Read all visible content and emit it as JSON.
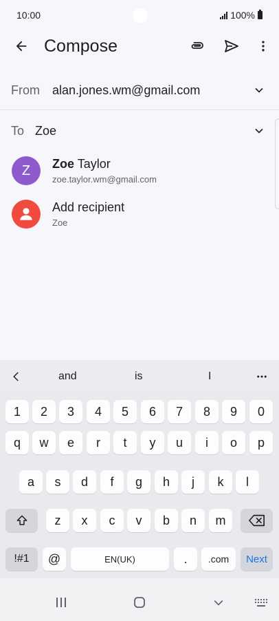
{
  "status_bar": {
    "time": "10:00",
    "battery": "100%"
  },
  "app_bar": {
    "title": "Compose"
  },
  "from": {
    "label": "From",
    "value": "alan.jones.wm@gmail.com"
  },
  "to": {
    "label": "To",
    "value": "Zoe"
  },
  "suggestions": [
    {
      "initial": "Z",
      "name_bold": "Zoe",
      "name_rest": " Taylor",
      "email": "zoe.taylor.wm@gmail.com",
      "avatar_color": "#8e5bcf"
    },
    {
      "name": "Add recipient",
      "sub": "Zoe",
      "avatar_color": "#f04b3e"
    }
  ],
  "keyboard": {
    "suggestions": [
      "and",
      "is",
      "I"
    ],
    "number_row": [
      "1",
      "2",
      "3",
      "4",
      "5",
      "6",
      "7",
      "8",
      "9",
      "0"
    ],
    "row1": [
      "q",
      "w",
      "e",
      "r",
      "t",
      "y",
      "u",
      "i",
      "o",
      "p"
    ],
    "row2": [
      "a",
      "s",
      "d",
      "f",
      "g",
      "h",
      "j",
      "k",
      "l"
    ],
    "row3": [
      "z",
      "x",
      "c",
      "v",
      "b",
      "n",
      "m"
    ],
    "symbols_label": "!#1",
    "at_label": "@",
    "space_label": "EN(UK)",
    "period_label": ".",
    "dotcom_label": ".com",
    "next_label": "Next"
  },
  "icons": {
    "back": "arrow-left-icon",
    "attach": "paperclip-icon",
    "send": "send-icon",
    "more": "more-vert-icon",
    "expand": "chevron-down-icon",
    "person": "person-icon",
    "shift": "shift-icon",
    "backspace": "backspace-icon"
  }
}
